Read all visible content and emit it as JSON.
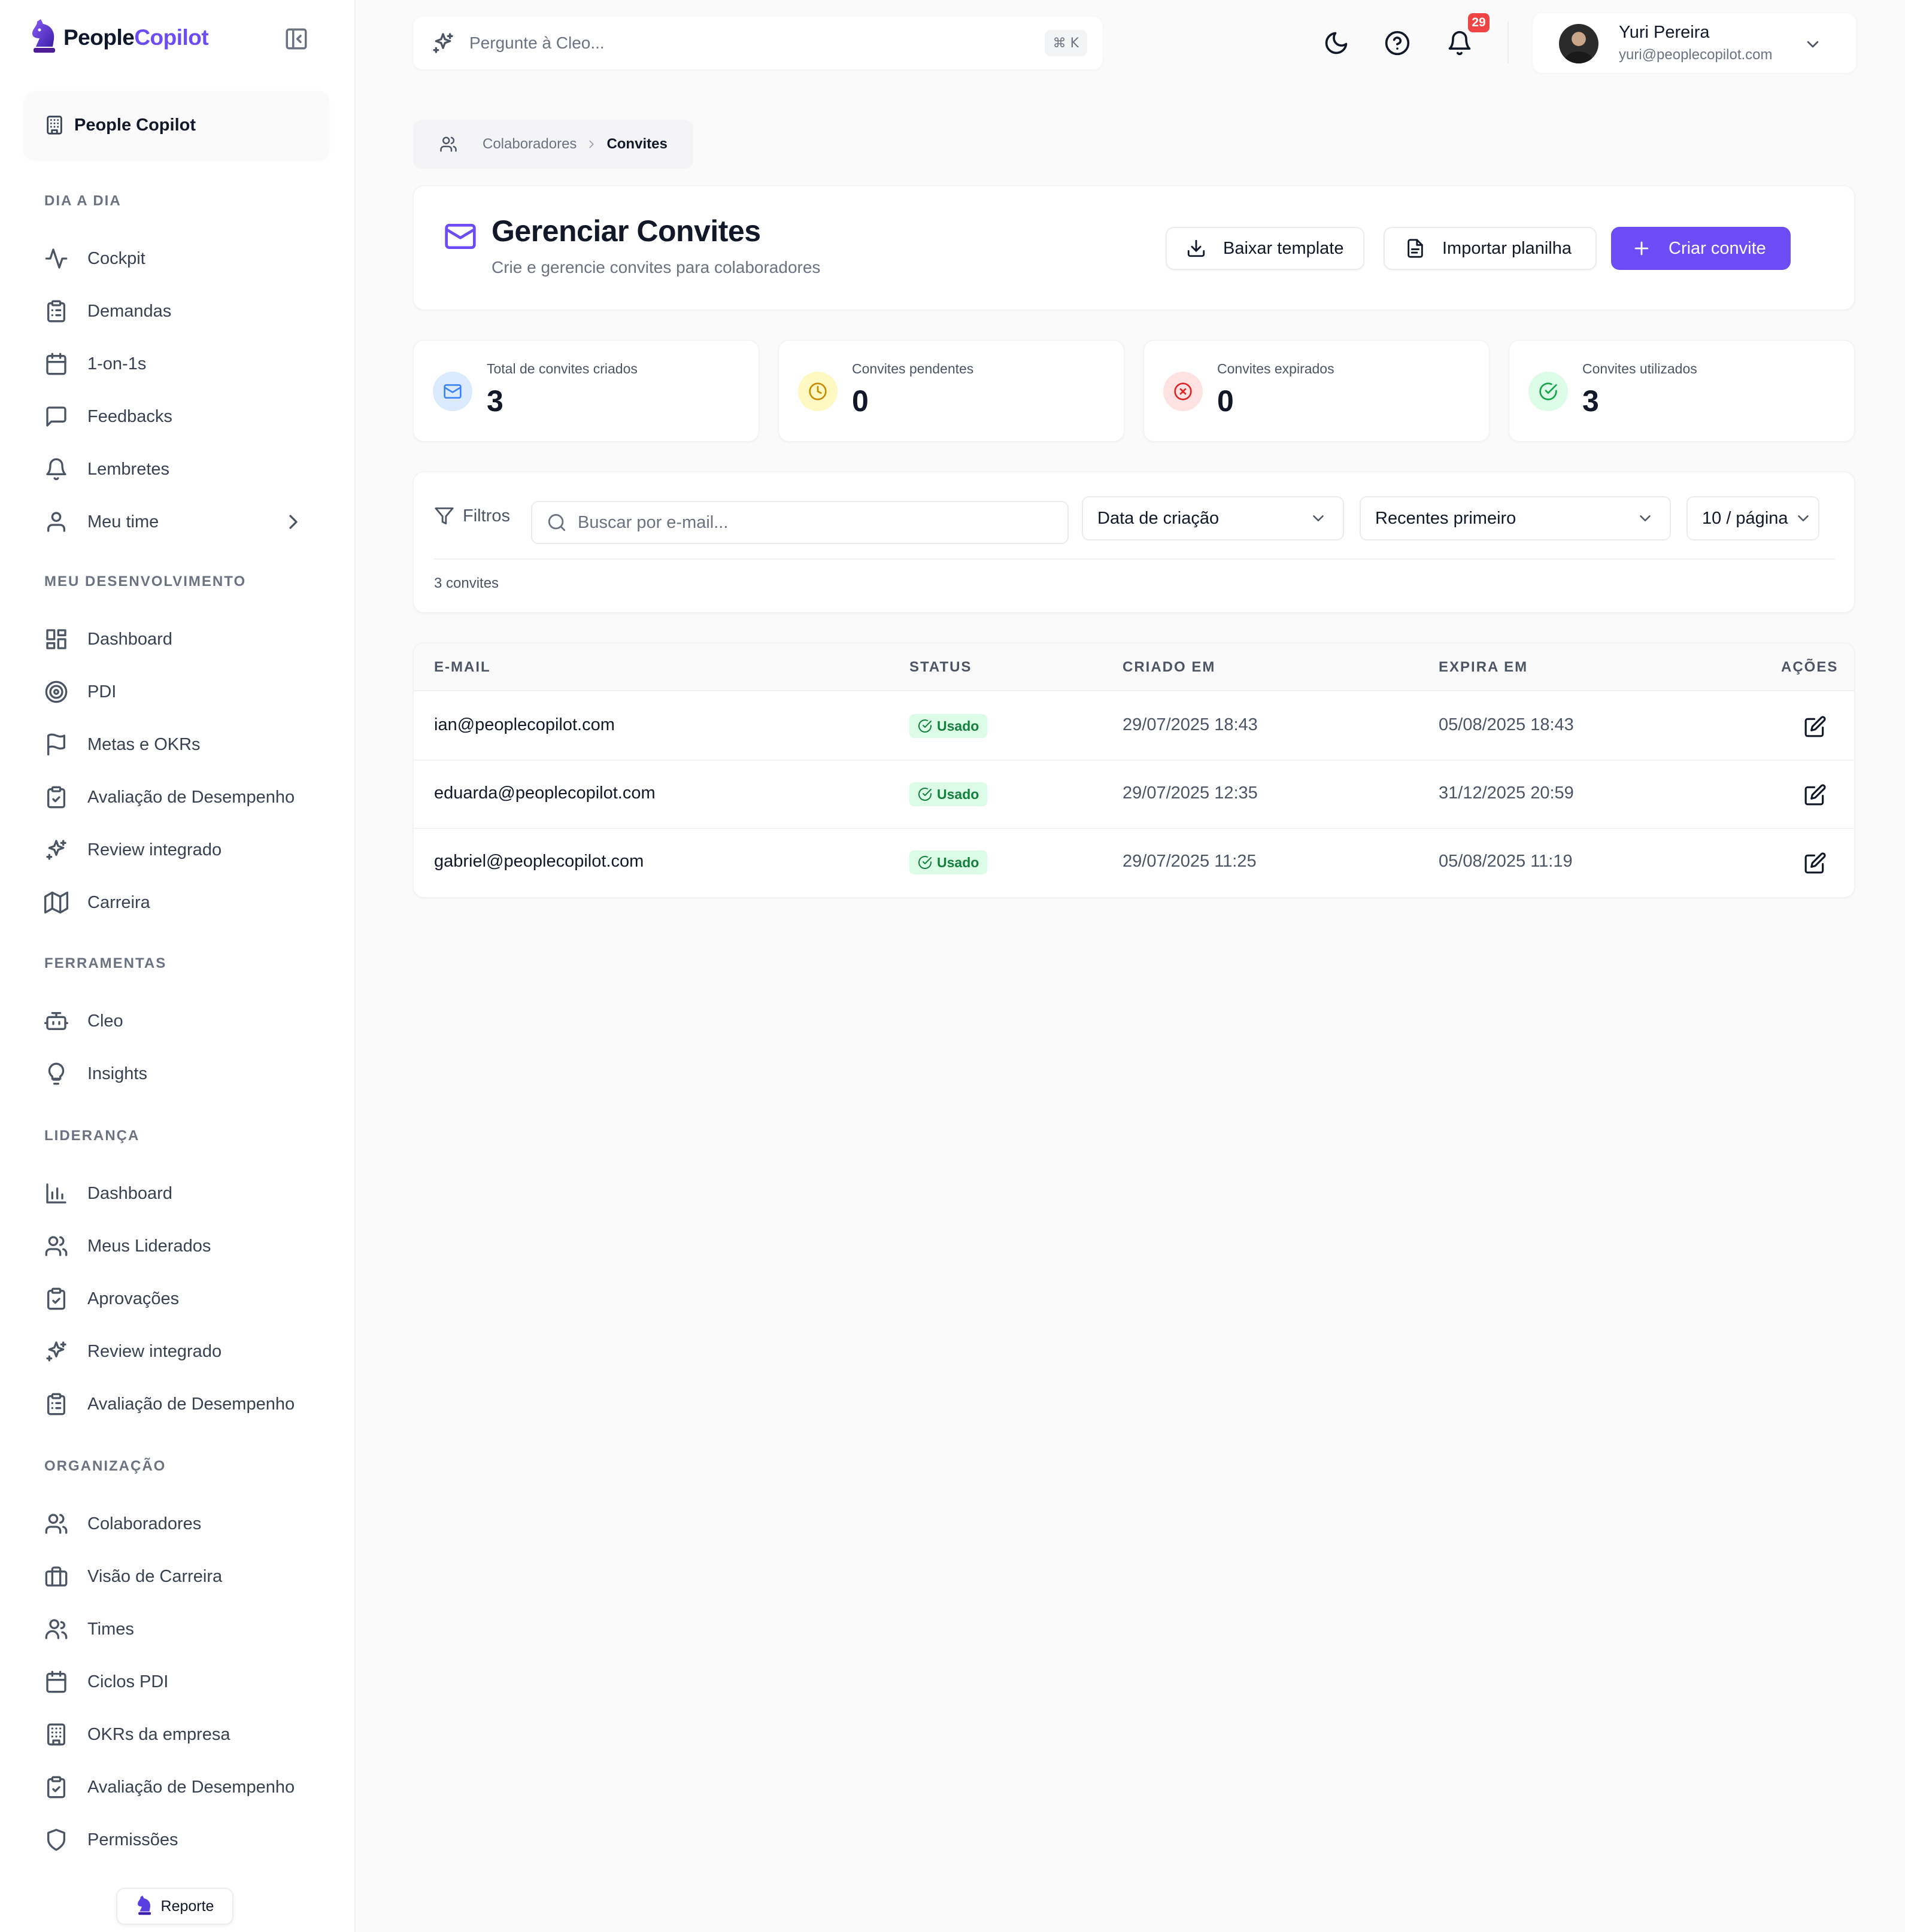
{
  "brand": {
    "part1": "People",
    "part2": "Copilot",
    "accent": "#6d4cf5"
  },
  "org_switcher": {
    "label": "People Copilot",
    "icon": "building-icon"
  },
  "sidebar": {
    "sections": [
      {
        "title": "DIA A DIA",
        "items": [
          {
            "label": "Cockpit",
            "icon": "activity-icon"
          },
          {
            "label": "Demandas",
            "icon": "clipboard-list-icon"
          },
          {
            "label": "1-on-1s",
            "icon": "calendar-icon"
          },
          {
            "label": "Feedbacks",
            "icon": "message-square-icon"
          },
          {
            "label": "Lembretes",
            "icon": "bell-icon"
          },
          {
            "label": "Meu time",
            "icon": "user-icon",
            "has_children": true
          }
        ]
      },
      {
        "title": "MEU DESENVOLVIMENTO",
        "items": [
          {
            "label": "Dashboard",
            "icon": "layout-dashboard-icon"
          },
          {
            "label": "PDI",
            "icon": "target-icon"
          },
          {
            "label": "Metas e OKRs",
            "icon": "flag-icon"
          },
          {
            "label": "Avaliação de Desempenho",
            "icon": "clipboard-check-icon"
          },
          {
            "label": "Review integrado",
            "icon": "sparkles-icon"
          },
          {
            "label": "Carreira",
            "icon": "map-icon"
          }
        ]
      },
      {
        "title": "FERRAMENTAS",
        "items": [
          {
            "label": "Cleo",
            "icon": "bot-icon"
          },
          {
            "label": "Insights",
            "icon": "lightbulb-icon"
          }
        ]
      },
      {
        "title": "LIDERANÇA",
        "items": [
          {
            "label": "Dashboard",
            "icon": "bar-chart-icon"
          },
          {
            "label": "Meus Liderados",
            "icon": "users-icon"
          },
          {
            "label": "Aprovações",
            "icon": "clipboard-check-icon"
          },
          {
            "label": "Review integrado",
            "icon": "sparkles-icon"
          },
          {
            "label": "Avaliação de Desempenho",
            "icon": "clipboard-list-icon"
          }
        ]
      },
      {
        "title": "ORGANIZAÇÃO",
        "items": [
          {
            "label": "Colaboradores",
            "icon": "users-icon"
          },
          {
            "label": "Visão de Carreira",
            "icon": "briefcase-icon"
          },
          {
            "label": "Times",
            "icon": "user-group-icon"
          },
          {
            "label": "Ciclos PDI",
            "icon": "calendar-icon"
          },
          {
            "label": "OKRs da empresa",
            "icon": "building-icon"
          },
          {
            "label": "Avaliação de Desempenho",
            "icon": "clipboard-check-icon"
          },
          {
            "label": "Permissões",
            "icon": "shield-icon"
          }
        ]
      }
    ],
    "report_button": "Reporte"
  },
  "topbar": {
    "search_placeholder": "Pergunte à Cleo...",
    "shortcut": "⌘ K",
    "notifications_count": "29",
    "user": {
      "name": "Yuri Pereira",
      "email": "yuri@peoplecopilot.com"
    }
  },
  "breadcrumb": {
    "parent": "Colaboradores",
    "current": "Convites"
  },
  "page": {
    "title": "Gerenciar Convites",
    "subtitle": "Crie e gerencie convites para colaboradores",
    "actions": {
      "download": "Baixar template",
      "import": "Importar planilha",
      "create": "Criar convite"
    }
  },
  "stats": [
    {
      "label": "Total de convites criados",
      "value": "3",
      "icon": "mail-icon",
      "color": "#3b82f6",
      "bg": "#dbeafe"
    },
    {
      "label": "Convites pendentes",
      "value": "0",
      "icon": "clock-icon",
      "color": "#ca8a04",
      "bg": "#fef9c3"
    },
    {
      "label": "Convites expirados",
      "value": "0",
      "icon": "x-circle-icon",
      "color": "#dc2626",
      "bg": "#fee2e2"
    },
    {
      "label": "Convites utilizados",
      "value": "3",
      "icon": "check-circle-icon",
      "color": "#16a34a",
      "bg": "#dcfce7"
    }
  ],
  "filters": {
    "label": "Filtros",
    "search_placeholder": "Buscar por e-mail...",
    "sort_field": "Data de criação",
    "sort_order": "Recentes primeiro",
    "page_size": "10 / página",
    "count_text": "3 convites"
  },
  "table": {
    "columns": [
      "E-MAIL",
      "STATUS",
      "CRIADO EM",
      "EXPIRA EM",
      "AÇÕES"
    ],
    "rows": [
      {
        "email": "ian@peoplecopilot.com",
        "status": "Usado",
        "created": "29/07/2025 18:43",
        "expires": "05/08/2025 18:43"
      },
      {
        "email": "eduarda@peoplecopilot.com",
        "status": "Usado",
        "created": "29/07/2025 12:35",
        "expires": "31/12/2025 20:59"
      },
      {
        "email": "gabriel@peoplecopilot.com",
        "status": "Usado",
        "created": "29/07/2025 11:25",
        "expires": "05/08/2025 11:19"
      }
    ]
  }
}
